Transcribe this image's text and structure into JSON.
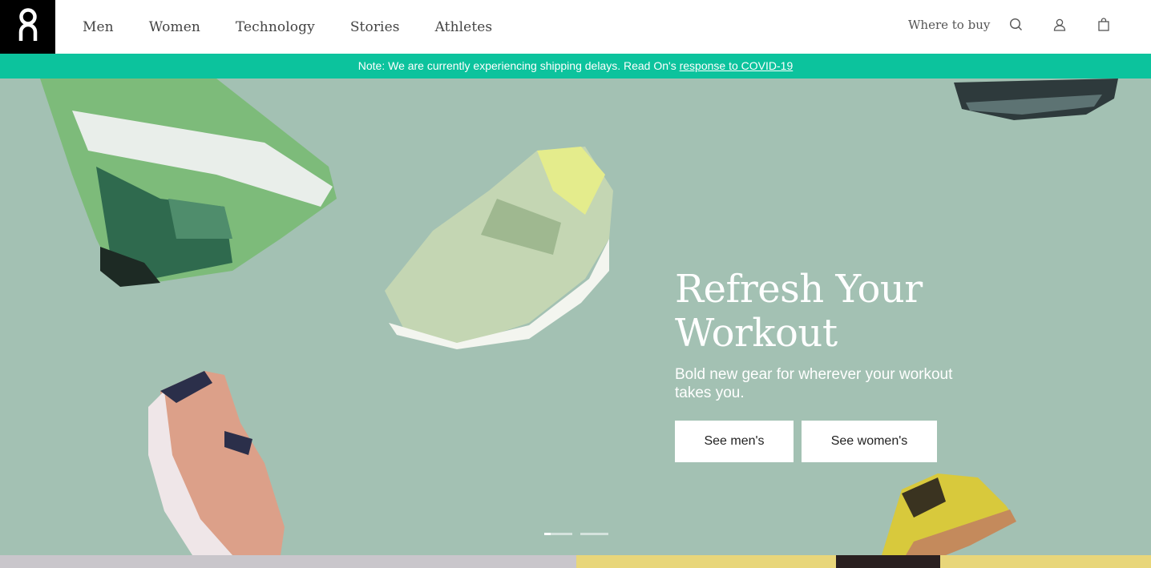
{
  "header": {
    "logo_alt": "On",
    "nav": [
      "Men",
      "Women",
      "Technology",
      "Stories",
      "Athletes"
    ],
    "where_to_buy": "Where to buy",
    "icons": [
      "search-icon",
      "account-icon",
      "cart-icon"
    ]
  },
  "banner": {
    "text": "Note: We are currently experiencing shipping delays. Read On's ",
    "link_text": "response to COVID-19",
    "color": "#0cc39d"
  },
  "hero": {
    "title_line1": "Refresh Your",
    "title_line2": "Workout",
    "subtitle": "Bold new gear for wherever your workout takes you.",
    "cta_men": "See men's",
    "cta_women": "See women's",
    "background": "#a3c1b3",
    "slides": 2,
    "active_slide": 1
  }
}
